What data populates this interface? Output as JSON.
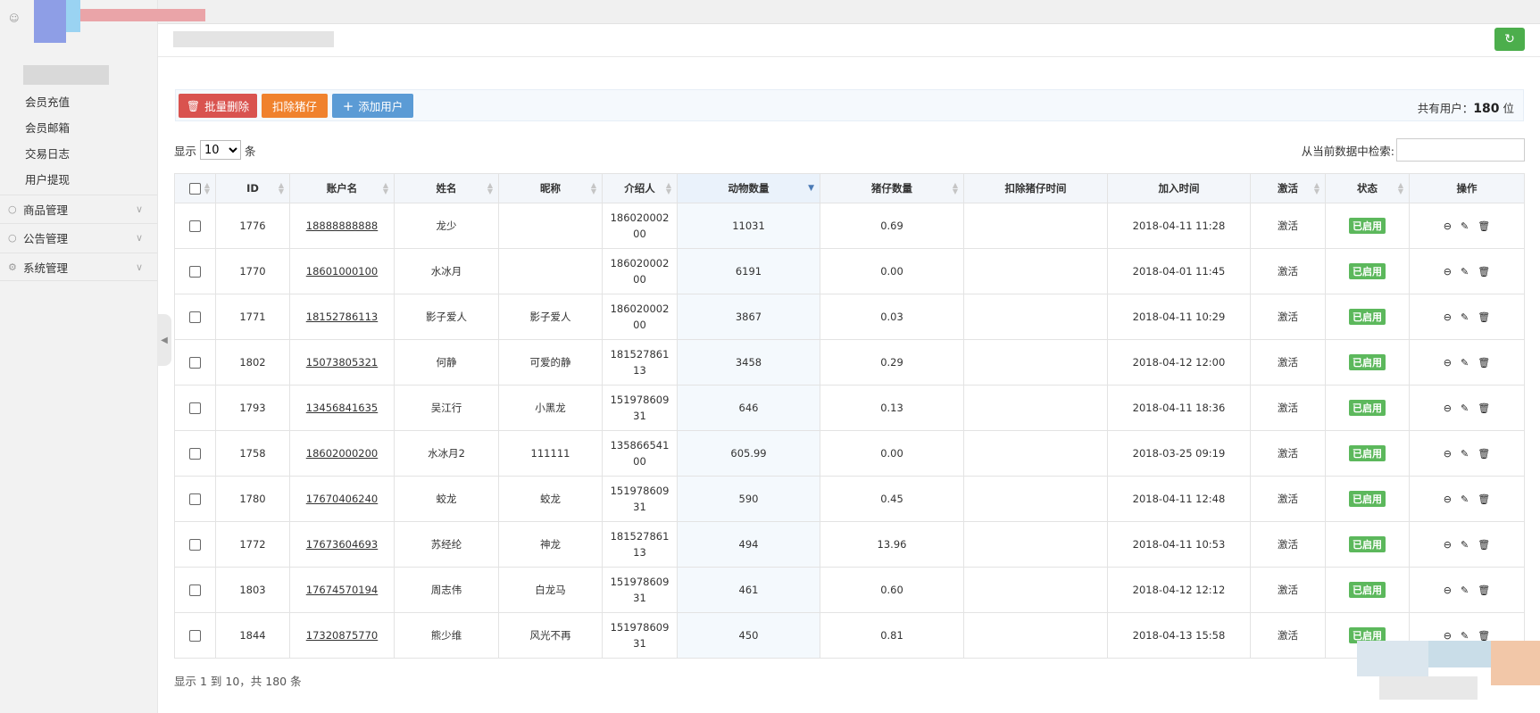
{
  "sidebar": {
    "sub_items": [
      "会员充值",
      "会员邮箱",
      "交易日志",
      "用户提现"
    ],
    "groups": [
      {
        "label": "商品管理",
        "icon": "chat-icon"
      },
      {
        "label": "公告管理",
        "icon": "chat-icon"
      },
      {
        "label": "系统管理",
        "icon": "gear-icon"
      }
    ]
  },
  "toolbar": {
    "batch_delete_label": "批量删除",
    "deduct_label": "扣除猪仔",
    "add_user_label": "添加用户",
    "total_prefix": "共有用户：",
    "total_count": "180",
    "total_unit": "位"
  },
  "length_control": {
    "prefix": "显示",
    "value": "10",
    "suffix": "条"
  },
  "search": {
    "label": "从当前数据中检索:"
  },
  "table": {
    "columns": [
      "ID",
      "账户名",
      "姓名",
      "昵称",
      "介绍人",
      "动物数量",
      "猪仔数量",
      "扣除猪仔时间",
      "加入时间",
      "激活",
      "状态",
      "操作"
    ],
    "rows": [
      {
        "id": "1776",
        "account": "18888888888",
        "name": "龙少",
        "nickname": "",
        "referrer": "18602000200",
        "animals": "11031",
        "piglets": "0.69",
        "deduct_time": "",
        "join_time": "2018-04-11 11:28",
        "active": "激活",
        "status": "已启用"
      },
      {
        "id": "1770",
        "account": "18601000100",
        "name": "水冰月",
        "nickname": "",
        "referrer": "18602000200",
        "animals": "6191",
        "piglets": "0.00",
        "deduct_time": "",
        "join_time": "2018-04-01 11:45",
        "active": "激活",
        "status": "已启用"
      },
      {
        "id": "1771",
        "account": "18152786113",
        "name": "影子爱人",
        "nickname": "影子爱人",
        "referrer": "18602000200",
        "animals": "3867",
        "piglets": "0.03",
        "deduct_time": "",
        "join_time": "2018-04-11 10:29",
        "active": "激活",
        "status": "已启用"
      },
      {
        "id": "1802",
        "account": "15073805321",
        "name": "何静",
        "nickname": "可爱的静",
        "referrer": "18152786113",
        "animals": "3458",
        "piglets": "0.29",
        "deduct_time": "",
        "join_time": "2018-04-12 12:00",
        "active": "激活",
        "status": "已启用"
      },
      {
        "id": "1793",
        "account": "13456841635",
        "name": "吴江行",
        "nickname": "小黑龙",
        "referrer": "15197860931",
        "animals": "646",
        "piglets": "0.13",
        "deduct_time": "",
        "join_time": "2018-04-11 18:36",
        "active": "激活",
        "status": "已启用"
      },
      {
        "id": "1758",
        "account": "18602000200",
        "name": "水冰月2",
        "nickname": "111111",
        "referrer": "13586654100",
        "animals": "605.99",
        "piglets": "0.00",
        "deduct_time": "",
        "join_time": "2018-03-25 09:19",
        "active": "激活",
        "status": "已启用"
      },
      {
        "id": "1780",
        "account": "17670406240",
        "name": "蛟龙",
        "nickname": "蛟龙",
        "referrer": "15197860931",
        "animals": "590",
        "piglets": "0.45",
        "deduct_time": "",
        "join_time": "2018-04-11 12:48",
        "active": "激活",
        "status": "已启用"
      },
      {
        "id": "1772",
        "account": "17673604693",
        "name": "苏经纶",
        "nickname": "神龙",
        "referrer": "18152786113",
        "animals": "494",
        "piglets": "13.96",
        "deduct_time": "",
        "join_time": "2018-04-11 10:53",
        "active": "激活",
        "status": "已启用"
      },
      {
        "id": "1803",
        "account": "17674570194",
        "name": "周志伟",
        "nickname": "白龙马",
        "referrer": "15197860931",
        "animals": "461",
        "piglets": "0.60",
        "deduct_time": "",
        "join_time": "2018-04-12 12:12",
        "active": "激活",
        "status": "已启用"
      },
      {
        "id": "1844",
        "account": "17320875770",
        "name": "熊少维",
        "nickname": "风光不再",
        "referrer": "15197860931",
        "animals": "450",
        "piglets": "0.81",
        "deduct_time": "",
        "join_time": "2018-04-13 15:58",
        "active": "激活",
        "status": "已启用"
      }
    ]
  },
  "footer_info": "显示 1 到 10，共 180 条",
  "colors": {
    "danger": "#d9534f",
    "warning": "#f0822d",
    "primary": "#5b9bd5",
    "success": "#5cb85c",
    "refresh": "#4cae4c"
  }
}
